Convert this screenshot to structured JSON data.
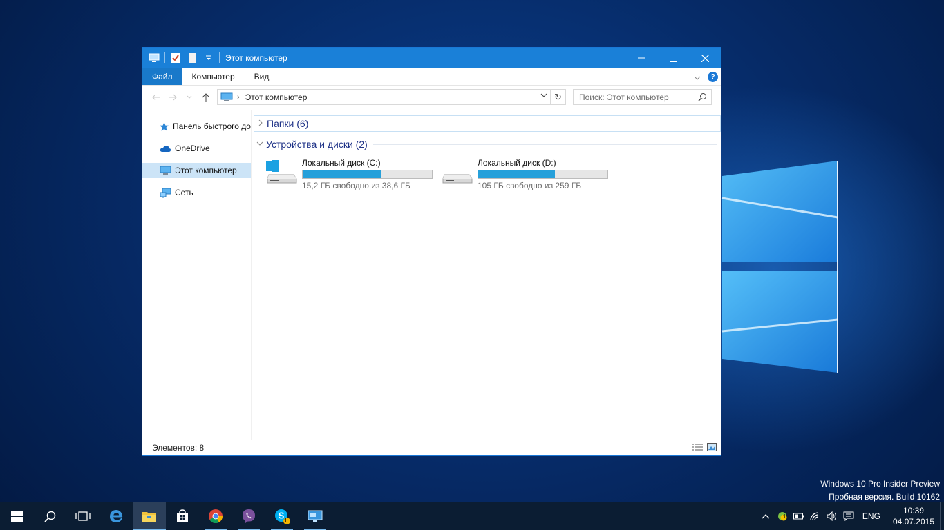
{
  "window": {
    "title": "Этот компьютер",
    "ribbon_tabs": [
      "Файл",
      "Компьютер",
      "Вид"
    ],
    "help": "?",
    "address": "Этот компьютер",
    "search_placeholder": "Поиск: Этот компьютер"
  },
  "nav_pane": {
    "items": [
      {
        "label": "Панель быстрого доступа",
        "icon": "star-icon"
      },
      {
        "label": "OneDrive",
        "icon": "cloud-icon"
      },
      {
        "label": "Этот компьютер",
        "icon": "computer-icon",
        "selected": true
      },
      {
        "label": "Сеть",
        "icon": "network-icon"
      }
    ]
  },
  "groups": [
    {
      "label": "Папки (6)",
      "expanded": false
    },
    {
      "label": "Устройства и диски (2)",
      "expanded": true
    }
  ],
  "drives": [
    {
      "name": "Локальный диск (C:)",
      "free_text": "15,2 ГБ свободно из 38,6 ГБ",
      "used_fraction": 0.606,
      "icon": "windows-drive-icon"
    },
    {
      "name": "Локальный диск (D:)",
      "free_text": "105 ГБ свободно из 259 ГБ",
      "used_fraction": 0.595,
      "icon": "hard-drive-icon"
    }
  ],
  "status": {
    "items_count": "Элементов: 8"
  },
  "watermark": {
    "line1": "Windows 10 Pro Insider Preview",
    "line2": "Пробная версия. Build 10162"
  },
  "taskbar": {
    "apps": [
      "start",
      "search",
      "task-view",
      "edge",
      "file-explorer",
      "store",
      "chrome",
      "viber",
      "skype",
      "remote-desktop"
    ],
    "skype_badge": "1",
    "tray_badge": "1",
    "language": "ENG",
    "time": "10:39",
    "date": "04.07.2015"
  },
  "colors": {
    "accent": "#1a80d8",
    "progress": "#26a0da",
    "taskbar": "#0b1d33"
  }
}
